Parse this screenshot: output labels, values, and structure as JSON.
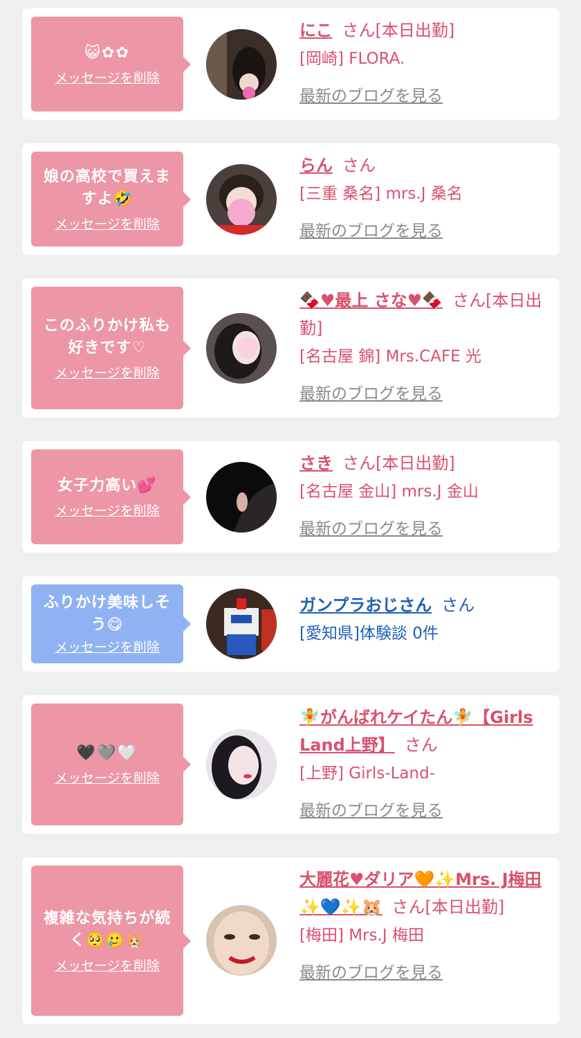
{
  "delete_label": "メッセージを削除",
  "blog_label": "最新のブログを見る",
  "colors": {
    "pink_bubble": "#ec96a6",
    "blue_bubble": "#8fb3f2",
    "pink_text": "#d9506e",
    "blue_text": "#1f5fb5"
  },
  "items": [
    {
      "message": "😺✿✿",
      "name": "にこ",
      "suffix": "さん[本日出勤]",
      "shop": "[岡崎] FLORA.",
      "avatar": "photo-dark-hair"
    },
    {
      "message": "娘の高校で買えますよ🤣",
      "name": "らん",
      "suffix": "さん",
      "shop": "[三重 桑名] mrs.J 桑名",
      "avatar": "photo-pink-stamp"
    },
    {
      "message": "このふりかけ私も好きです♡",
      "name": "🍫♥最上 さな♥🍫",
      "suffix": "さん[本日出勤]",
      "shop": "[名古屋 錦] Mrs.CAFE 光",
      "avatar": "photo-heart-stamp"
    },
    {
      "message": "女子力高い💕",
      "name": "さき",
      "suffix": "さん[本日出勤]",
      "shop": "[名古屋 金山] mrs.J 金山",
      "avatar": "photo-ear"
    },
    {
      "message": "ふりかけ美味しそう😋",
      "name": "ガンプラおじさん",
      "suffix": "さん",
      "shop": "[愛知県]体験談 0件",
      "avatar": "photo-robot"
    },
    {
      "message": "🖤🩶🤍",
      "name": "🧚がんばれケイたん🧚【Girls Land上野】",
      "suffix": "さん",
      "shop": "[上野] Girls-Land-",
      "avatar": "photo-long-hair"
    },
    {
      "message": "複雑な気持ちが続く🥺🥲🐹",
      "name": "大麗花♥ダリア🧡✨Mrs. J梅田✨💙✨🐹",
      "suffix": "さん[本日出勤]",
      "shop": "[梅田] Mrs.J 梅田",
      "avatar": "photo-face"
    }
  ]
}
